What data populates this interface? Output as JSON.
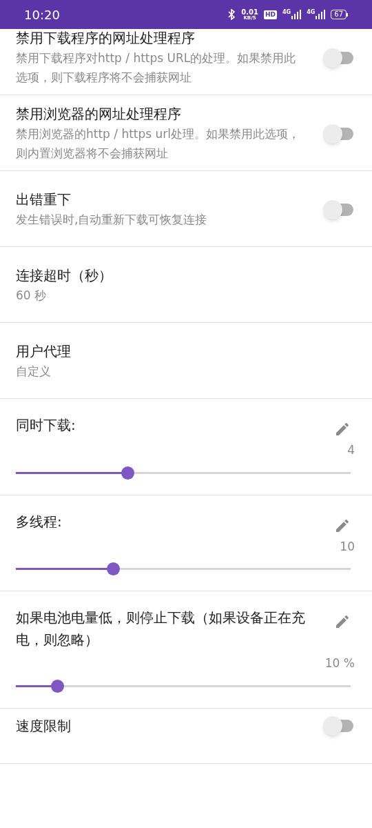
{
  "status_bar": {
    "time": "10:20",
    "speed": "0.01",
    "speed_unit": "KB/S",
    "hd": "HD",
    "net1": "4G",
    "net2": "4G",
    "battery": "67"
  },
  "settings": [
    {
      "kind": "switch",
      "title": "禁用下载程序的网址处理程序",
      "subtitle": "禁用下载程序对http / https URL的处理。如果禁用此选项，则下载程序将不会捕获网址",
      "on": false
    },
    {
      "kind": "switch",
      "title": "禁用浏览器的网址处理程序",
      "subtitle": "禁用浏览器的http / https url处理。如果禁用此选项，则内置浏览器将不会捕获网址",
      "on": false
    },
    {
      "kind": "switch",
      "title": "出错重下",
      "subtitle": "发生错误时,自动重新下载可恢复连接",
      "on": false
    },
    {
      "kind": "text",
      "title": "连接超时（秒）",
      "subtitle": "60 秒"
    },
    {
      "kind": "text",
      "title": "用户代理",
      "subtitle": "自定义"
    },
    {
      "kind": "slider",
      "title": "同时下载:",
      "value": "4",
      "level": 0.333
    },
    {
      "kind": "slider",
      "title": "多线程:",
      "value": "10",
      "level": 0.29
    },
    {
      "kind": "slider",
      "title": "如果电池电量低，则停止下载（如果设备正在充电，则忽略）",
      "value": "10 %",
      "level": 0.124
    },
    {
      "kind": "switch",
      "title": "速度限制",
      "on": false
    }
  ]
}
